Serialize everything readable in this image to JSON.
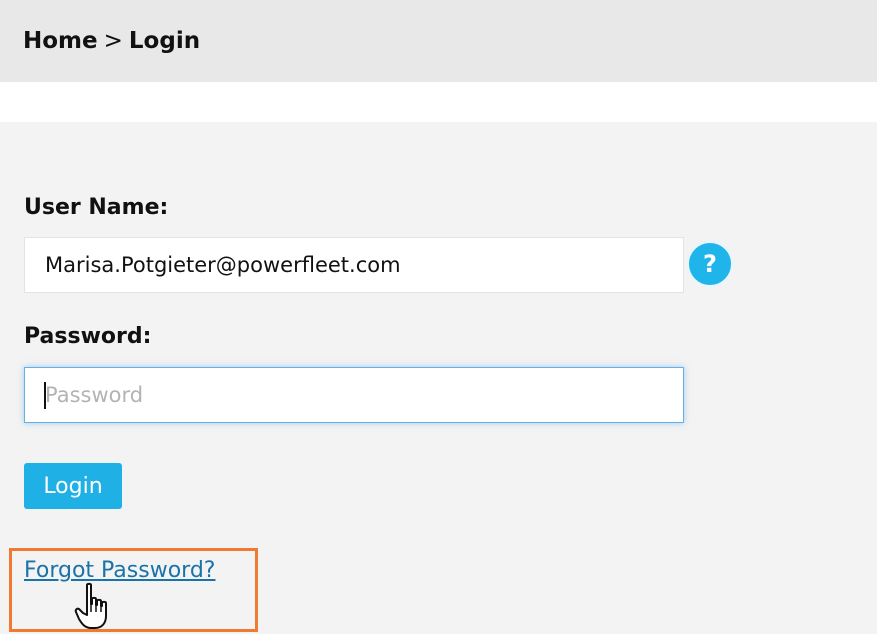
{
  "breadcrumb": {
    "home": "Home",
    "separator": ">",
    "current": "Login"
  },
  "form": {
    "username_label": "User Name:",
    "username_value": "Marisa.Potgieter@powerfleet.com",
    "help_icon_glyph": "?",
    "password_label": "Password:",
    "password_placeholder": "Password",
    "login_label": "Login",
    "forgot_link": "Forgot Password?"
  },
  "icons": {
    "help": "help-icon",
    "cursor": "hand-pointer-icon"
  },
  "colors": {
    "accent": "#1fb0e6",
    "link": "#1a73a8",
    "highlight": "#ef7b33"
  }
}
